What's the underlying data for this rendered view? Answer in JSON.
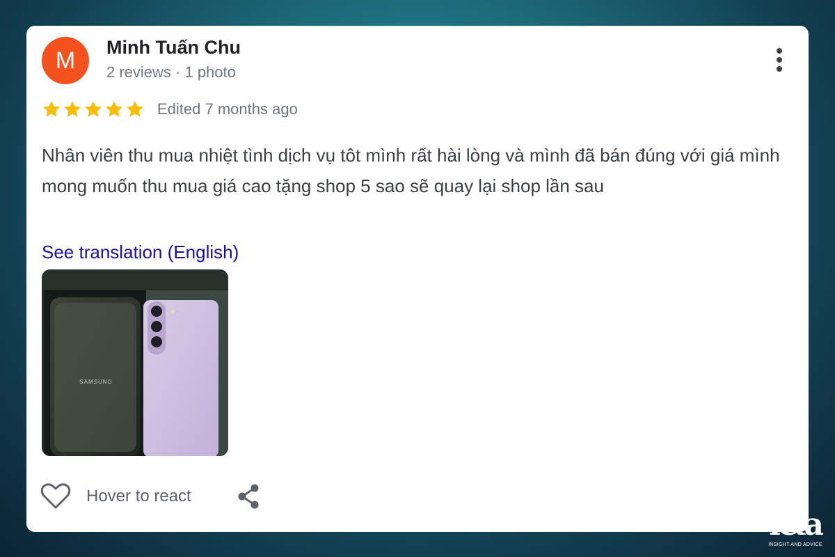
{
  "reviewer": {
    "initial": "M",
    "name": "Minh Tuấn Chu",
    "meta": "2 reviews · 1 photo",
    "avatar_color": "#f4511e"
  },
  "rating": {
    "stars": 5,
    "star_color": "#fbbc04",
    "edited": "Edited 7 months ago"
  },
  "review": {
    "text": "Nhân viên thu mua nhiệt tình dịch vụ tôt mình rất hài lòng và mình đã bán đúng với giá mình mong muốn thu mua giá cao tặng shop 5 sao sẽ quay lại shop lần sau",
    "translation_link": "See translation (English)",
    "photo_brand_text": "SAMSUNG"
  },
  "actions": {
    "react_label": "Hover to react",
    "more_icon": "more-vert-icon",
    "heart_icon": "heart-outline-icon",
    "share_icon": "share-icon"
  },
  "watermark": {
    "mark": "i&a",
    "tagline": "INSIGHT AND ADVICE"
  },
  "colors": {
    "link": "#1a0dab",
    "text": "#3c4043",
    "secondary": "#70757a"
  }
}
